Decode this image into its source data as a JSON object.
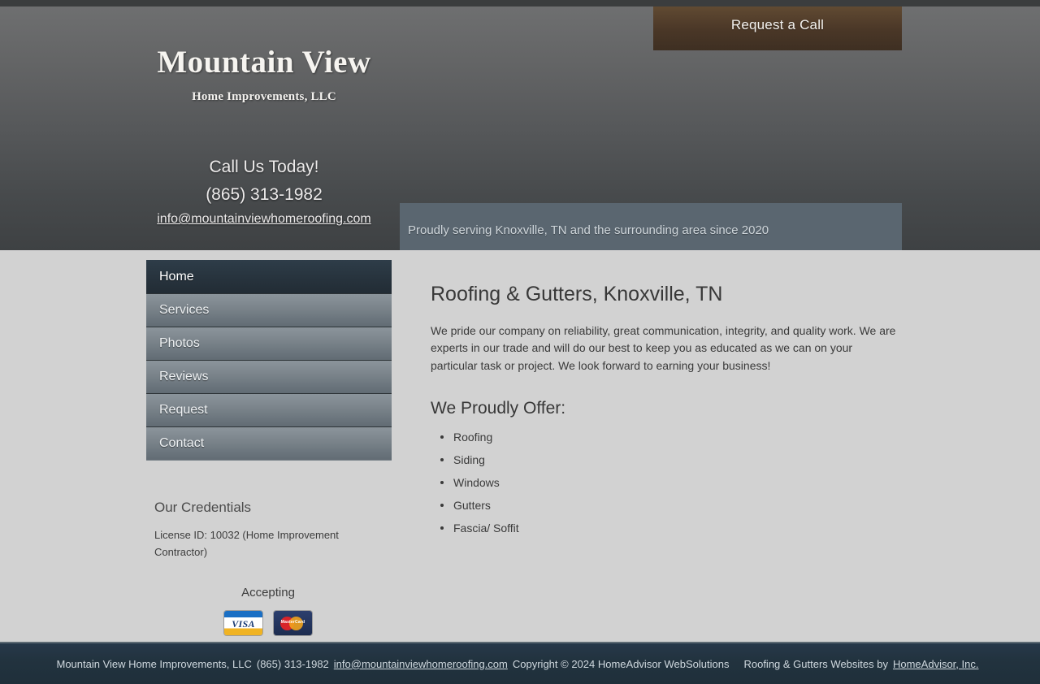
{
  "header": {
    "request_call_label": "Request a Call",
    "logo_title": "Mountain View",
    "logo_subtitle": "Home Improvements, LLC",
    "cta": "Call Us Today!",
    "phone": "(865) 313-1982",
    "email": "info@mountainviewhomeroofing.com",
    "tagline": "Proudly serving Knoxville, TN and the surrounding area since 2020"
  },
  "sidebar": {
    "nav": [
      {
        "label": "Home",
        "active": true
      },
      {
        "label": "Services",
        "active": false
      },
      {
        "label": "Photos",
        "active": false
      },
      {
        "label": "Reviews",
        "active": false
      },
      {
        "label": "Request",
        "active": false
      },
      {
        "label": "Contact",
        "active": false
      }
    ],
    "credentials_title": "Our Credentials",
    "credentials_text": "License ID: 10032 (Home Improvement Contractor)",
    "accepting_label": "Accepting",
    "cards": [
      {
        "name": "visa-card-icon",
        "label": "VISA"
      },
      {
        "name": "mastercard-card-icon",
        "label": "MasterCard"
      }
    ]
  },
  "main": {
    "title": "Roofing & Gutters, Knoxville, TN",
    "paragraph": "We pride our company on reliability, great communication, integrity, and quality work. We are experts in our trade and will do our best to keep you as educated as we can on your particular task or project. We look forward to earning your business!",
    "offer_title": "We Proudly Offer:",
    "offers": [
      "Roofing",
      "Siding",
      "Windows",
      "Gutters",
      "Fascia/ Soffit"
    ]
  },
  "footer": {
    "company": "Mountain View Home Improvements, LLC",
    "phone": "(865) 313-1982",
    "email": "info@mountainviewhomeroofing.com",
    "copyright": "Copyright © 2024 HomeAdvisor WebSolutions",
    "credit_prefix": "Roofing & Gutters Websites by",
    "credit_link": "HomeAdvisor, Inc."
  },
  "colors": {
    "accent_button": "#4a3727",
    "nav_active": "#27333d",
    "footer_bg": "#22333f",
    "content_bg": "#d2d2d2",
    "tagline_bg": "#5a6670"
  }
}
